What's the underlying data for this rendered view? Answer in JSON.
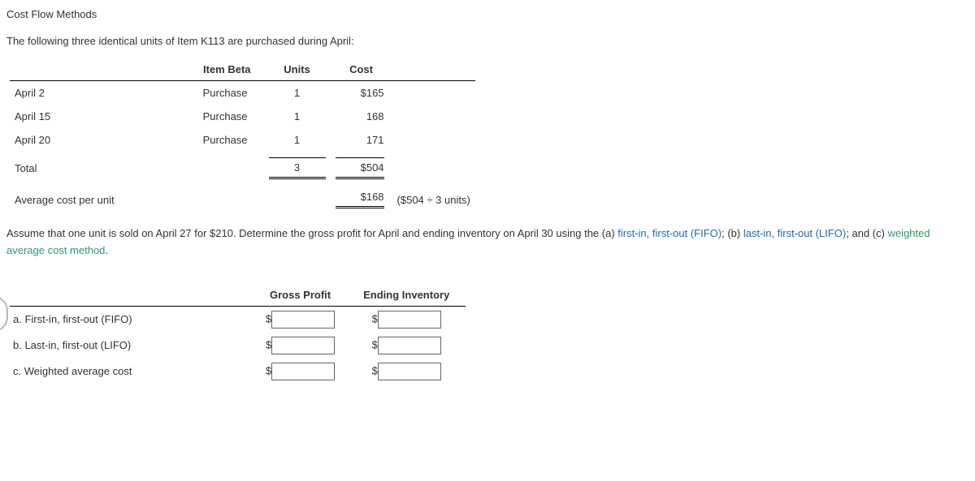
{
  "title": "Cost Flow Methods",
  "intro": "The following three identical units of Item K113 are purchased during April:",
  "purchase_table": {
    "headers": {
      "item": "Item Beta",
      "units": "Units",
      "cost": "Cost"
    },
    "rows": [
      {
        "date": "April 2",
        "desc": "Purchase",
        "units": "1",
        "cost": "$165"
      },
      {
        "date": "April 15",
        "desc": "Purchase",
        "units": "1",
        "cost": "168"
      },
      {
        "date": "April 20",
        "desc": "Purchase",
        "units": "1",
        "cost": "171"
      }
    ],
    "total_label": "Total",
    "total_units": "3",
    "total_cost": "$504",
    "avg_label": "Average cost per unit",
    "avg_cost": "$168",
    "avg_calc": "($504 ÷ 3 units)"
  },
  "question": {
    "part1": "Assume that one unit is sold on April 27 for $210. Determine the gross profit for April and ending inventory on April 30 using the (a) ",
    "fifo": "first-in, first-out (FIFO)",
    "sep1": "; (b) ",
    "lifo": "last-in, first-out (LIFO)",
    "sep2": "; and (c) ",
    "wac": "weighted average cost method",
    "end": "."
  },
  "answer_table": {
    "headers": {
      "gp": "Gross Profit",
      "ei": "Ending Inventory"
    },
    "rows": [
      {
        "label": "a. First-in, first-out (FIFO)"
      },
      {
        "label": "b. Last-in, first-out (LIFO)"
      },
      {
        "label": "c. Weighted average cost"
      }
    ],
    "currency": "$"
  }
}
